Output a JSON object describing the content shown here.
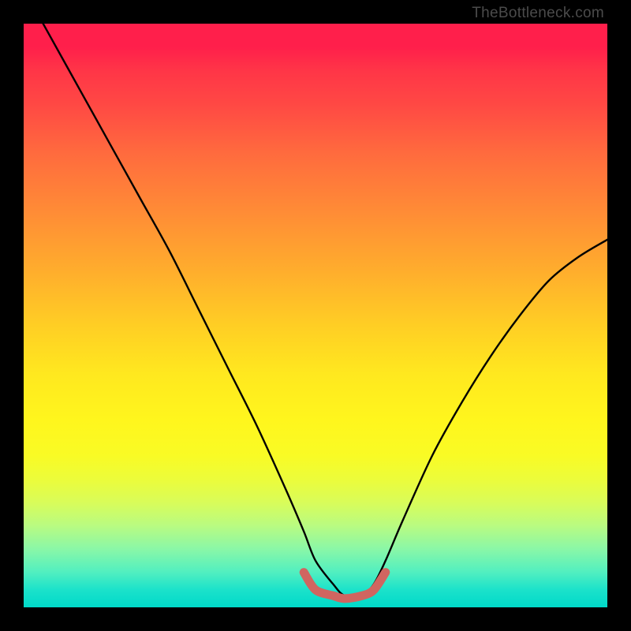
{
  "watermark": "TheBottleneck.com",
  "colors": {
    "frame": "#000000",
    "curve_stroke": "#000000",
    "bottom_highlight": "#d06560"
  },
  "chart_data": {
    "type": "line",
    "title": "",
    "xlabel": "",
    "ylabel": "",
    "xlim": [
      0,
      100
    ],
    "ylim": [
      0,
      100
    ],
    "series": [
      {
        "name": "bottleneck-curve",
        "x": [
          0,
          5,
          10,
          15,
          20,
          25,
          30,
          35,
          40,
          45,
          48,
          50,
          53,
          55,
          58,
          60,
          62,
          65,
          70,
          75,
          80,
          85,
          90,
          95,
          100
        ],
        "values": [
          106,
          97,
          88,
          79,
          70,
          61,
          51,
          41,
          31,
          20,
          13,
          8,
          4,
          2,
          2,
          4,
          8,
          15,
          26,
          35,
          43,
          50,
          56,
          60,
          63
        ]
      },
      {
        "name": "bottom-highlight",
        "x": [
          48,
          50,
          53,
          55,
          58,
          60,
          62
        ],
        "values": [
          6,
          3,
          2,
          1.5,
          2,
          3,
          6
        ]
      }
    ],
    "annotations": []
  }
}
